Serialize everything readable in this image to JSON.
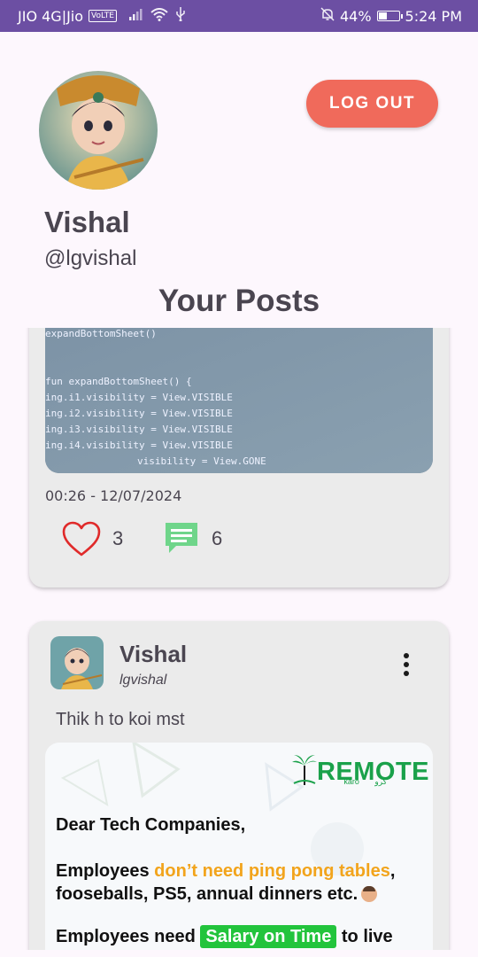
{
  "status_bar": {
    "carrier": "JIO 4G|Jio",
    "volte": "VoLTE",
    "signal_icon": "signal-icon",
    "wifi_icon": "wifi-icon",
    "usb_icon": "usb-icon",
    "mute_icon": "bell-off-icon",
    "battery_percent": "44%",
    "battery_level": 0.44,
    "time": "5:24 PM",
    "bar_color": "#6c4fa3"
  },
  "profile": {
    "name": "Vishal",
    "handle": "@lgvishal",
    "logout_label": "LOG OUT",
    "logout_color": "#f06a5b"
  },
  "section_title": "Your Posts",
  "posts": [
    {
      "image_code_lines": [
        "expandBottomSheet()",
        "fun expandBottomSheet() {",
        "ing.i1.visibility = View.VISIBLE",
        "ing.i2.visibility = View.VISIBLE",
        "ing.i3.visibility = View.VISIBLE",
        "ing.i4.visibility = View.VISIBLE",
        "visibility = View.GONE"
      ],
      "timestamp": "00:26 - 12/07/2024",
      "likes": "3",
      "comments": "6",
      "like_icon": "heart-outline-icon",
      "comment_icon": "comment-icon",
      "like_color": "#e02a2a",
      "comment_color": "#6fd58a"
    },
    {
      "author": "Vishal",
      "handle": "lgvishal",
      "text": "Thik h to koi mst",
      "menu_icon": "more-vertical-icon",
      "image": {
        "brand": "REMOTE",
        "brand_sub": "karo",
        "brand_urdu": "کرو",
        "line1": "Dear Tech Companies,",
        "line2_a": "Employees ",
        "line2_b": "don’t need ping pong tables",
        "line2_c": ",",
        "line3": "fooseballs, PS5, annual dinners etc.",
        "line4_a": "Employees need ",
        "line4_badge": "Salary on Time",
        "line4_b": " to live",
        "accent_orange": "#f2a41c",
        "accent_green": "#22c43c"
      }
    }
  ]
}
